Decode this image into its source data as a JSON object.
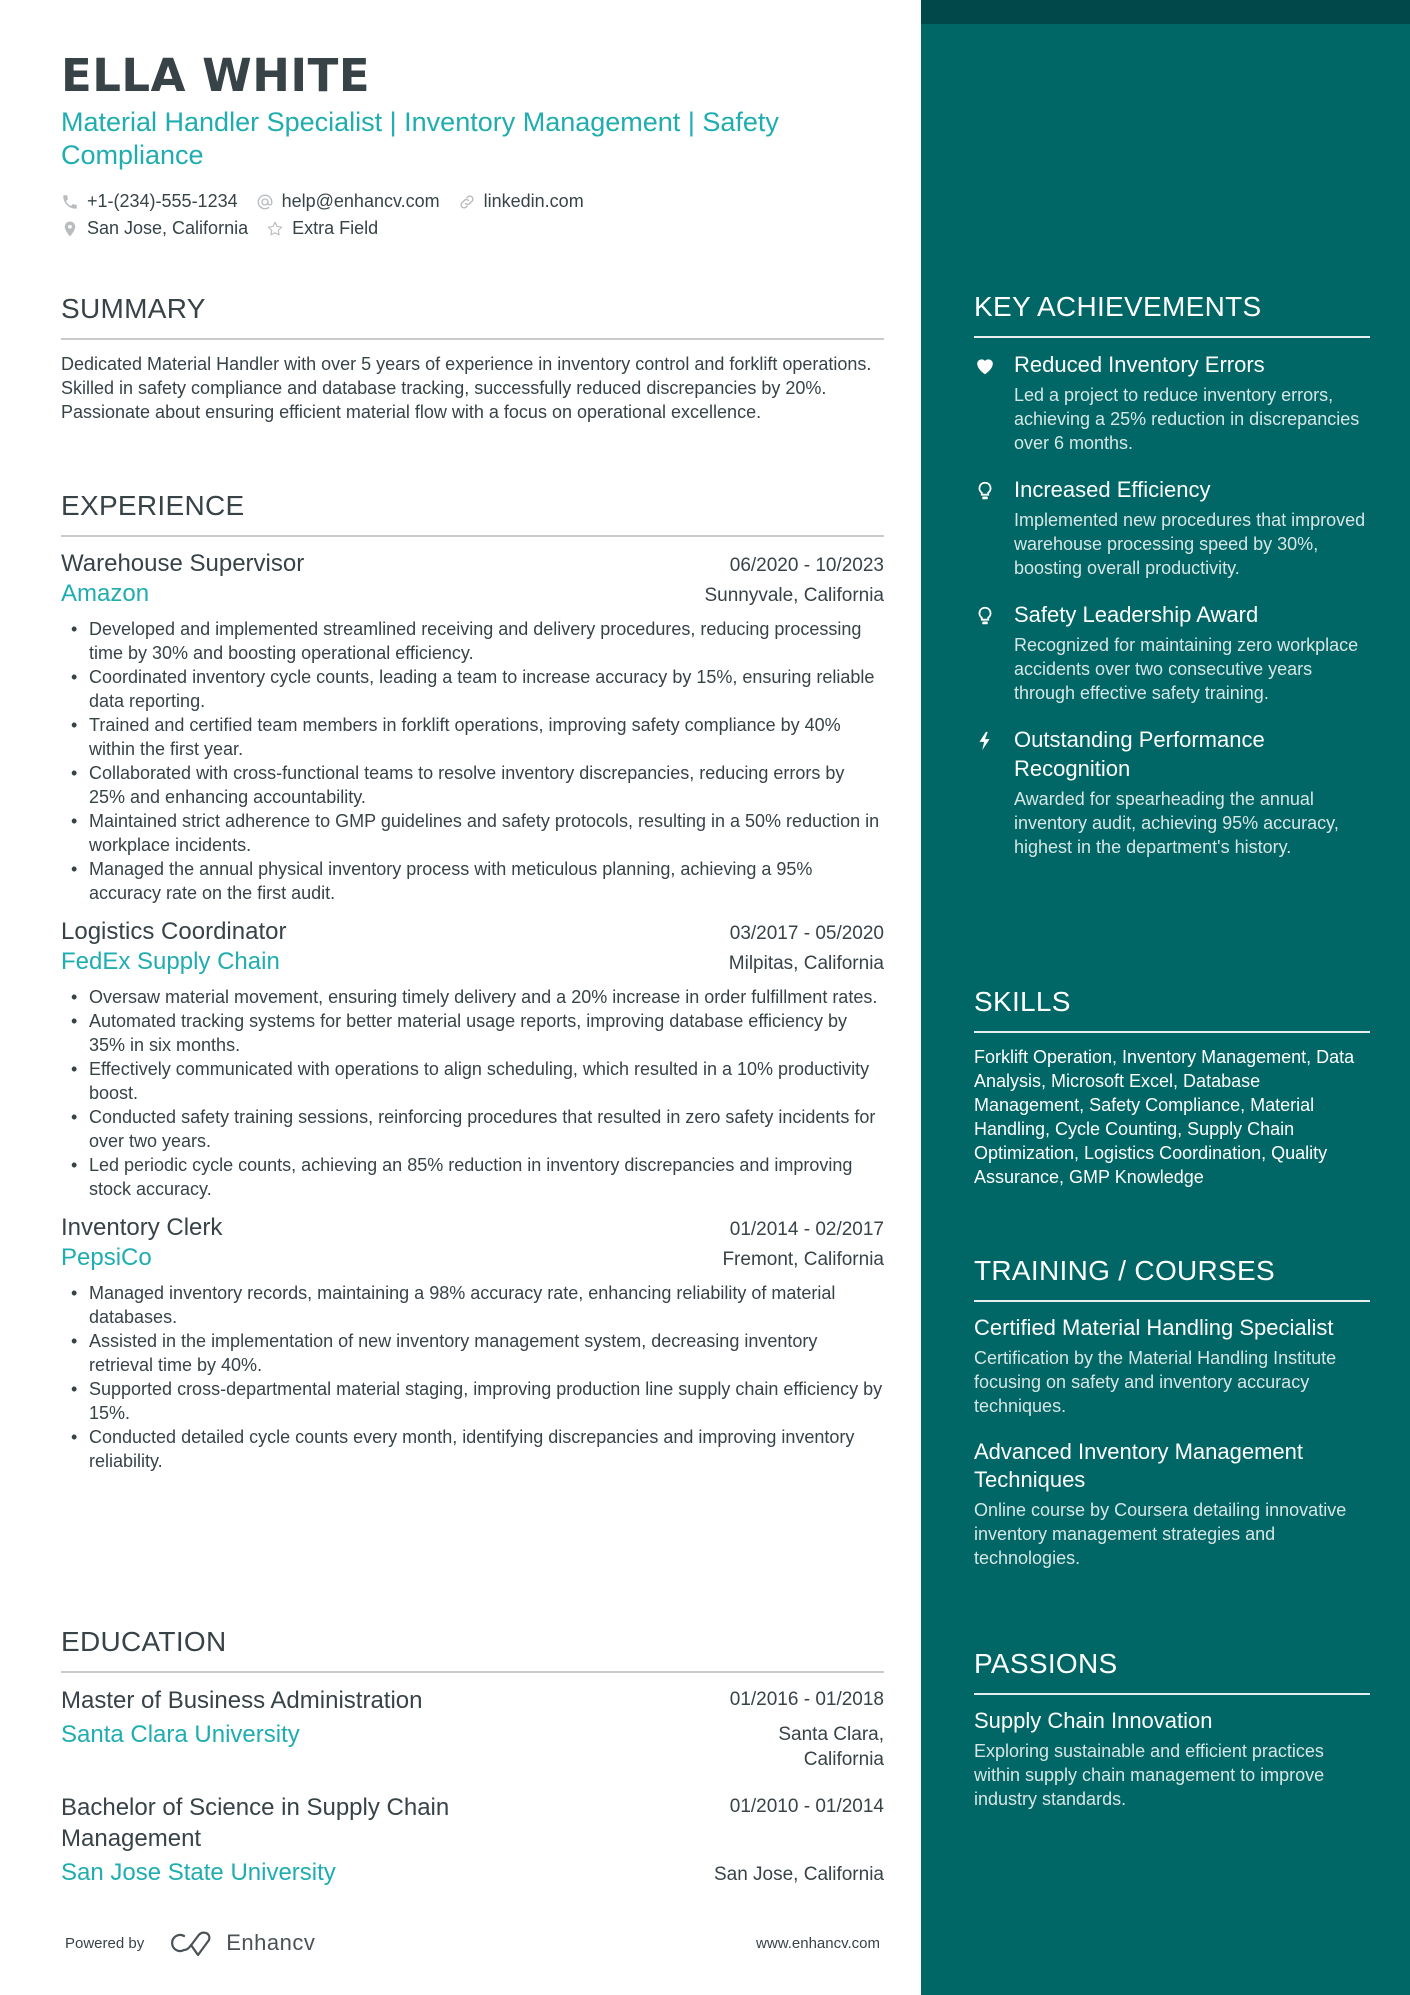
{
  "header": {
    "name": "ELLA WHITE",
    "title": "Material Handler Specialist | Inventory Management | Safety Compliance",
    "contacts": {
      "phone": {
        "icon": "phone-icon",
        "value": "+1-(234)-555-1234"
      },
      "email": {
        "icon": "at-icon",
        "value": "help@enhancv.com"
      },
      "linkedin": {
        "icon": "link-icon",
        "value": "linkedin.com"
      },
      "location": {
        "icon": "location-pin-icon",
        "value": "San Jose, California"
      },
      "extra": {
        "icon": "star-icon",
        "value": "Extra Field"
      }
    }
  },
  "summary": {
    "heading": "SUMMARY",
    "text": "Dedicated Material Handler with over 5 years of experience in inventory control and forklift operations. Skilled in safety compliance and database tracking, successfully reduced discrepancies by 20%. Passionate about ensuring efficient material flow with a focus on operational excellence."
  },
  "experience": {
    "heading": "EXPERIENCE",
    "jobs": [
      {
        "title": "Warehouse Supervisor",
        "dates": "06/2020 - 10/2023",
        "company": "Amazon",
        "location": "Sunnyvale, California",
        "bullets": [
          "Developed and implemented streamlined receiving and delivery procedures, reducing processing time by 30% and boosting operational efficiency.",
          "Coordinated inventory cycle counts, leading a team to increase accuracy by 15%, ensuring reliable data reporting.",
          "Trained and certified team members in forklift operations, improving safety compliance by 40% within the first year.",
          "Collaborated with cross-functional teams to resolve inventory discrepancies, reducing errors by 25% and enhancing accountability.",
          "Maintained strict adherence to GMP guidelines and safety protocols, resulting in a 50% reduction in workplace incidents.",
          "Managed the annual physical inventory process with meticulous planning, achieving a 95% accuracy rate on the first audit."
        ]
      },
      {
        "title": "Logistics Coordinator",
        "dates": "03/2017 - 05/2020",
        "company": "FedEx Supply Chain",
        "location": "Milpitas, California",
        "bullets": [
          "Oversaw material movement, ensuring timely delivery and a 20% increase in order fulfillment rates.",
          "Automated tracking systems for better material usage reports, improving database efficiency by 35% in six months.",
          "Effectively communicated with operations to align scheduling, which resulted in a 10% productivity boost.",
          "Conducted safety training sessions, reinforcing procedures that resulted in zero safety incidents for over two years.",
          "Led periodic cycle counts, achieving an 85% reduction in inventory discrepancies and improving stock accuracy."
        ]
      },
      {
        "title": "Inventory Clerk",
        "dates": "01/2014 - 02/2017",
        "company": "PepsiCo",
        "location": "Fremont, California",
        "bullets": [
          "Managed inventory records, maintaining a 98% accuracy rate, enhancing reliability of material databases.",
          "Assisted in the implementation of new inventory management system, decreasing inventory retrieval time by 40%.",
          "Supported cross-departmental material staging, improving production line supply chain efficiency by 15%.",
          "Conducted detailed cycle counts every month, identifying discrepancies and improving inventory reliability."
        ]
      }
    ]
  },
  "education": {
    "heading": "EDUCATION",
    "items": [
      {
        "degree": "Master of Business Administration",
        "dates": "01/2016 - 01/2018",
        "school": "Santa Clara University",
        "location": "Santa Clara, California"
      },
      {
        "degree": "Bachelor of Science in Supply Chain Management",
        "dates": "01/2010 - 01/2014",
        "school": "San Jose State University",
        "location": "San Jose, California"
      }
    ]
  },
  "footer": {
    "powered_by": "Powered by",
    "brand": "Enhancv",
    "website": "www.enhancv.com"
  },
  "sidebar": {
    "achievements": {
      "heading": "KEY ACHIEVEMENTS",
      "items": [
        {
          "icon": "heart-icon",
          "title": "Reduced Inventory Errors",
          "desc": "Led a project to reduce inventory errors, achieving a 25% reduction in discrepancies over 6 months."
        },
        {
          "icon": "lightbulb-icon",
          "title": "Increased Efficiency",
          "desc": "Implemented new procedures that improved warehouse processing speed by 30%, boosting overall productivity."
        },
        {
          "icon": "lightbulb-icon",
          "title": "Safety Leadership Award",
          "desc": "Recognized for maintaining zero workplace accidents over two consecutive years through effective safety training."
        },
        {
          "icon": "lightning-bolt-icon",
          "title": "Outstanding Performance Recognition",
          "desc": "Awarded for spearheading the annual inventory audit, achieving 95% accuracy, highest in the department's history."
        }
      ]
    },
    "skills": {
      "heading": "SKILLS",
      "text": "Forklift Operation, Inventory Management, Data Analysis, Microsoft Excel, Database Management, Safety Compliance, Material Handling, Cycle Counting, Supply Chain Optimization, Logistics Coordination, Quality Assurance, GMP Knowledge"
    },
    "training": {
      "heading": "TRAINING / COURSES",
      "items": [
        {
          "title": "Certified Material Handling Specialist",
          "desc": "Certification by the Material Handling Institute focusing on safety and inventory accuracy techniques."
        },
        {
          "title": "Advanced Inventory Management Techniques",
          "desc": "Online course by Coursera detailing innovative inventory management strategies and technologies."
        }
      ]
    },
    "passions": {
      "heading": "PASSIONS",
      "items": [
        {
          "title": "Supply Chain Innovation",
          "desc": "Exploring sustainable and efficient practices within supply chain management to improve industry standards."
        }
      ]
    }
  },
  "colors": {
    "accent": "#1fadb0",
    "text": "#384347",
    "sidebar_bg": "#006766",
    "sidebar_band": "#004849"
  }
}
